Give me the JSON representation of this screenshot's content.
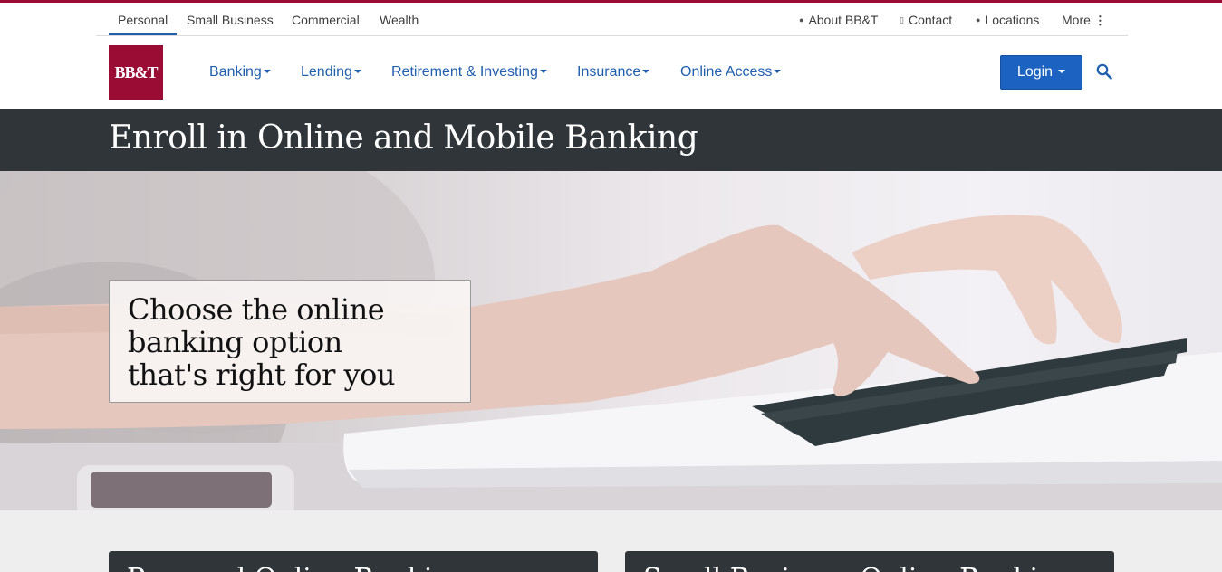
{
  "brand": {
    "logo_text": "BB&T",
    "color": "#9b0c35"
  },
  "utility_nav": {
    "segments": [
      "Personal",
      "Small Business",
      "Commercial",
      "Wealth"
    ],
    "active_segment": "Personal",
    "links": [
      {
        "label": "About BB&T",
        "icon": "person-icon"
      },
      {
        "label": "Contact",
        "icon": "phone-icon"
      },
      {
        "label": "Locations",
        "icon": "map-pin-icon"
      },
      {
        "label": "More",
        "icon": "more-vertical-icon"
      }
    ]
  },
  "main_nav": {
    "items": [
      "Banking",
      "Lending",
      "Retirement & Investing",
      "Insurance",
      "Online Access"
    ],
    "login_label": "Login",
    "accent": "#1f5fae"
  },
  "page_title": "Enroll in Online and Mobile Banking",
  "hero": {
    "lines": [
      "Choose the online",
      "banking option",
      "that's right for you"
    ]
  },
  "cards": [
    {
      "title": "Personal Online Banking"
    },
    {
      "title": "Small Business Online Banking"
    }
  ]
}
